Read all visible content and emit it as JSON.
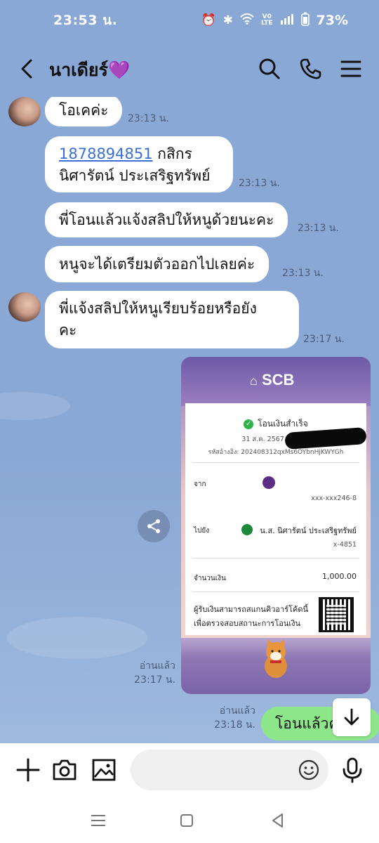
{
  "status_bar": {
    "time": "23:53 น.",
    "battery": "73%",
    "icons": [
      "alarm-icon",
      "bluetooth-icon",
      "wifi-icon",
      "volte-icon",
      "signal-icon",
      "battery-icon"
    ]
  },
  "header": {
    "title": "นาเดียร์💜",
    "icons": [
      "back-icon",
      "search-icon",
      "phone-icon",
      "menu-icon"
    ]
  },
  "messages": [
    {
      "text": "โอเคค่ะ",
      "time": "23:13 น."
    },
    {
      "account": "1878894851",
      "bank": " กสิกร",
      "name_line": "นิศารัตน์  ประเสริฐทรัพย์",
      "time": "23:13 น."
    },
    {
      "text": "พี่โอนแล้วแจ้งสลิปให้หนูด้วยนะคะ",
      "time": "23:13 น."
    },
    {
      "text": "หนูจะได้เตรียมตัวออกไปเลยค่ะ",
      "time": "23:13 น."
    },
    {
      "line1": "พี่แจ้งสลิปให้หนูเรียบร้อยหรือยัง",
      "line2": "คะ",
      "time": "23:17 น."
    }
  ],
  "receipt": {
    "brand": "SCB",
    "status": "โอนเงินสำเร็จ",
    "date": "31 ส.ค. 2567 - 23:17",
    "ref": "รหัสอ้างอิง: 202408312qxMs6OYbnHjKWYGh",
    "from_label": "จาก",
    "from_account": "xxx-xxx246-8",
    "to_label": "ไปยัง",
    "to_name": "น.ส. นิศารัตน์ ประเสริฐทรัพย์",
    "to_account": "x-4851",
    "amount_label": "จำนวนเงิน",
    "amount": "1,000.00",
    "qr_note_line1": "ผู้รับเงินสามารถสแกนคิวอาร์โค้ดนี้",
    "qr_note_line2": "เพื่อตรวจสอบสถานะการโอนเงิน"
  },
  "receipt_meta": {
    "read": "อ่านแล้ว",
    "time": "23:17 น."
  },
  "last_message": {
    "text": "โอนแล้วค่ะ",
    "read": "อ่านแล้ว",
    "time": "23:18 น."
  },
  "input": {
    "placeholder": ""
  },
  "colors": {
    "chat_bg": "#8aa8d6",
    "own_bubble": "#8ee68a",
    "link": "#3a6fd8"
  }
}
